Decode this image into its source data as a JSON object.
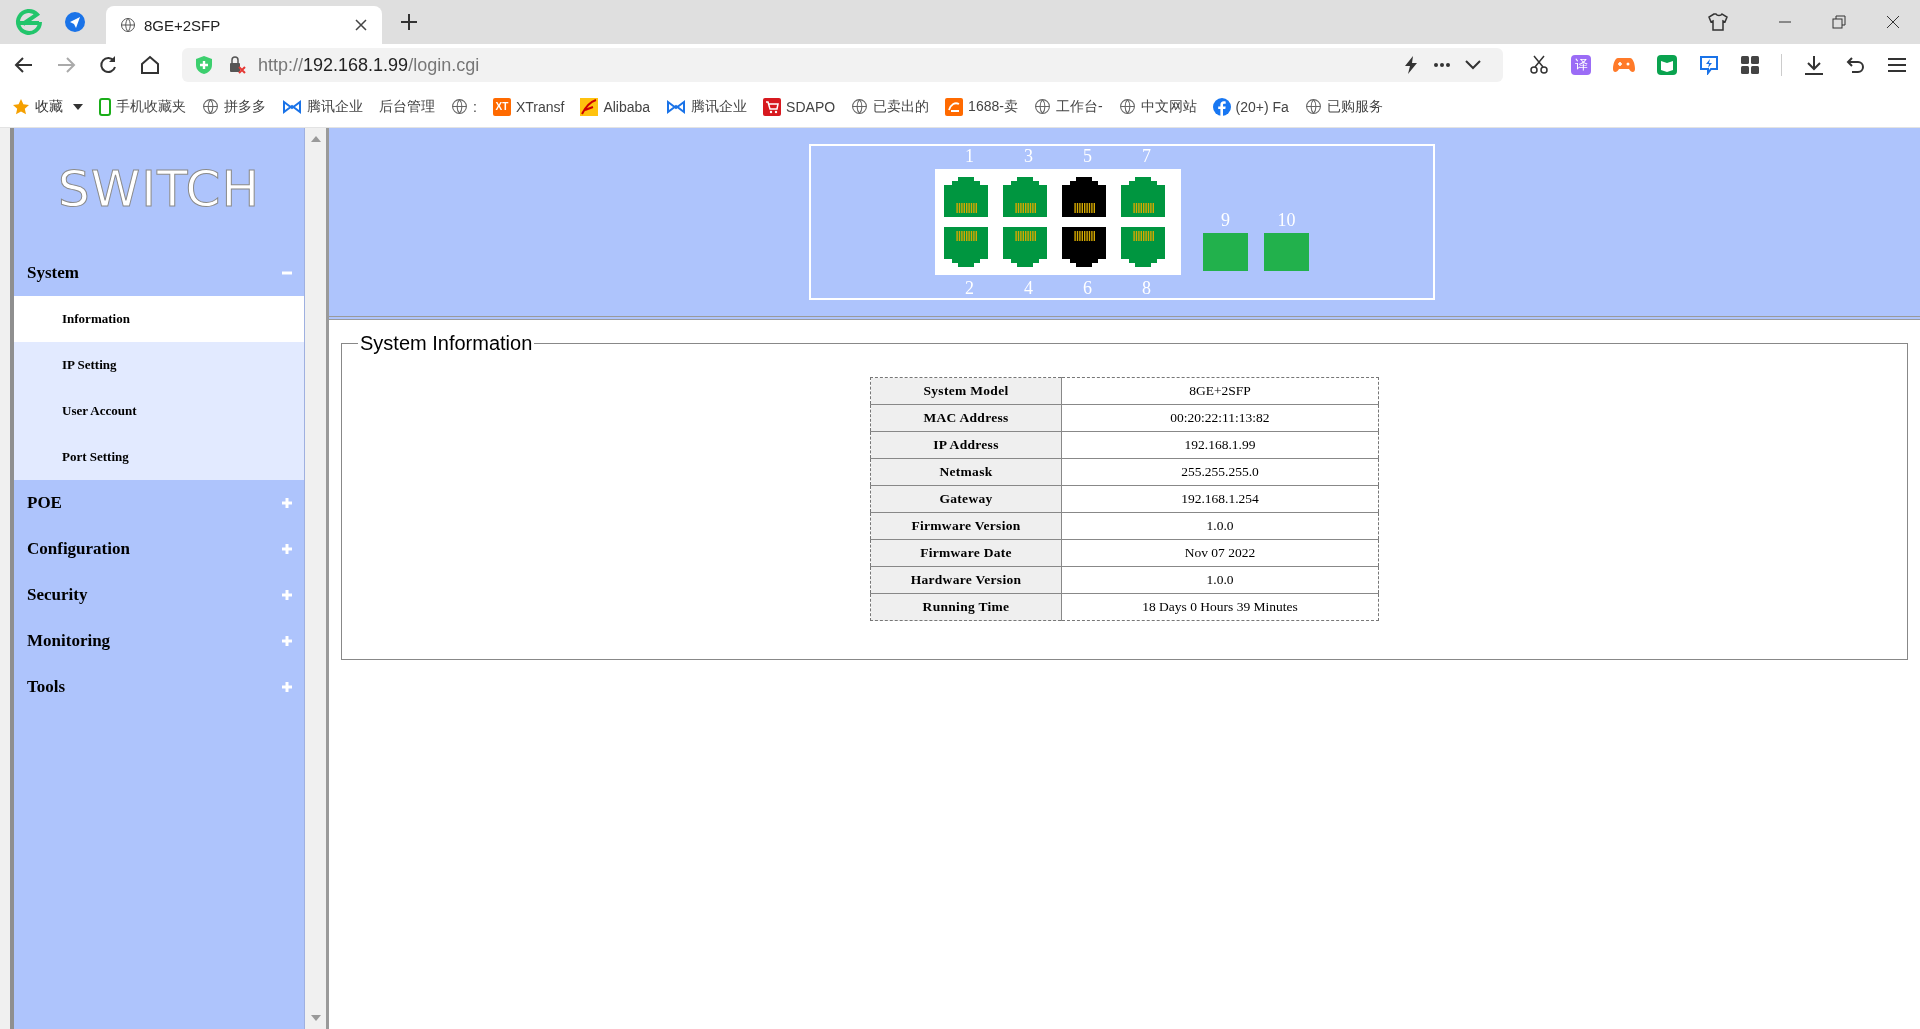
{
  "browser": {
    "tab": {
      "title": "8GE+2SFP",
      "selected": true
    },
    "url": {
      "scheme": "http://",
      "host": "192.168.1.99",
      "path": "/login.cgi"
    },
    "translate_label": "译",
    "bookmarks": [
      {
        "label": "收藏",
        "kind": "star"
      },
      {
        "label": "手机收藏夹",
        "kind": "phone"
      },
      {
        "label": "拼多多",
        "kind": "globe"
      },
      {
        "label": "腾讯企业",
        "kind": "bowtie"
      },
      {
        "label": "后台管理",
        "kind": "none"
      },
      {
        "label": ":",
        "kind": "globe"
      },
      {
        "label": "XTransf",
        "kind": "xt",
        "badge": "XT"
      },
      {
        "label": "Alibaba",
        "kind": "ali"
      },
      {
        "label": "腾讯企业",
        "kind": "bowtie"
      },
      {
        "label": "SDAPO",
        "kind": "cart"
      },
      {
        "label": "已卖出的",
        "kind": "globe"
      },
      {
        "label": "1688-卖",
        "kind": "orange"
      },
      {
        "label": "工作台-",
        "kind": "globe"
      },
      {
        "label": "中文网站",
        "kind": "globe"
      },
      {
        "label": "(20+) Fa",
        "kind": "fb"
      },
      {
        "label": "已购服务",
        "kind": "globe"
      }
    ]
  },
  "sidebar": {
    "logo": "SWITCH",
    "menu": [
      {
        "label": "System",
        "expanded": true,
        "children": [
          {
            "label": "Information",
            "selected": true
          },
          {
            "label": "IP Setting",
            "selected": false
          },
          {
            "label": "User Account",
            "selected": false
          },
          {
            "label": "Port Setting",
            "selected": false
          }
        ]
      },
      {
        "label": "POE",
        "expanded": false
      },
      {
        "label": "Configuration",
        "expanded": false
      },
      {
        "label": "Security",
        "expanded": false
      },
      {
        "label": "Monitoring",
        "expanded": false
      },
      {
        "label": "Tools",
        "expanded": false
      }
    ]
  },
  "ports": {
    "rj45": [
      {
        "label": "1",
        "linked": true
      },
      {
        "label": "2",
        "linked": true
      },
      {
        "label": "3",
        "linked": true
      },
      {
        "label": "4",
        "linked": true
      },
      {
        "label": "5",
        "linked": false
      },
      {
        "label": "6",
        "linked": false
      },
      {
        "label": "7",
        "linked": true
      },
      {
        "label": "8",
        "linked": true
      }
    ],
    "sfp": [
      {
        "label": "9",
        "linked": true
      },
      {
        "label": "10",
        "linked": true
      }
    ]
  },
  "panel": {
    "title": "System Information",
    "rows": [
      {
        "label": "System Model",
        "value": "8GE+2SFP"
      },
      {
        "label": "MAC Address",
        "value": "00:20:22:11:13:82"
      },
      {
        "label": "IP Address",
        "value": "192.168.1.99"
      },
      {
        "label": "Netmask",
        "value": "255.255.255.0"
      },
      {
        "label": "Gateway",
        "value": "192.168.1.254"
      },
      {
        "label": "Firmware Version",
        "value": "1.0.0"
      },
      {
        "label": "Firmware Date",
        "value": "Nov 07 2022"
      },
      {
        "label": "Hardware Version",
        "value": "1.0.0"
      },
      {
        "label": "Running Time",
        "value": "18 Days 0 Hours 39 Minutes"
      }
    ]
  }
}
